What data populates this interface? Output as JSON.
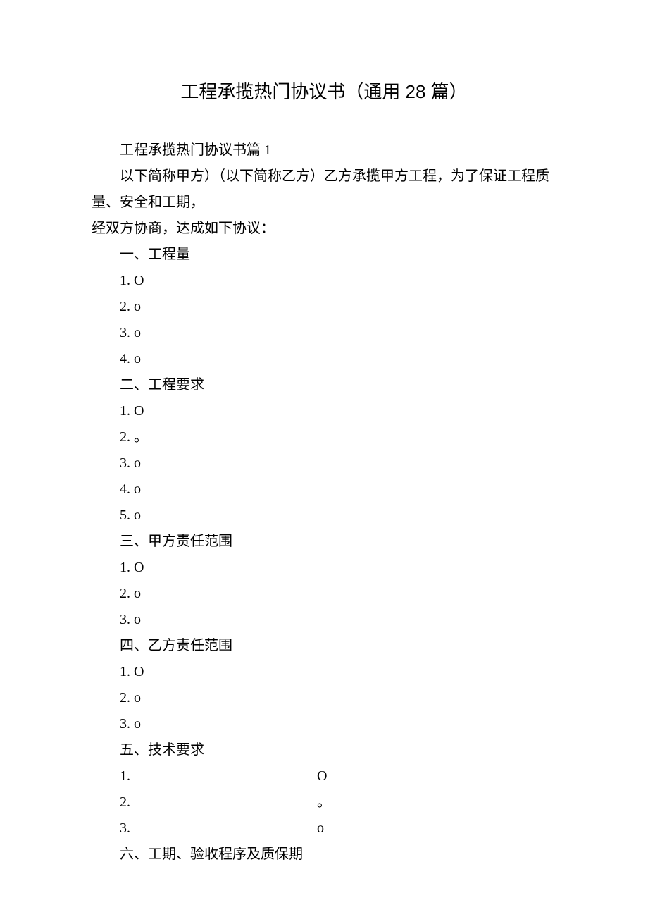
{
  "title": "工程承揽热门协议书（通用 28 篇）",
  "para1": "工程承揽热门协议书篇 1",
  "para2": "以下简称甲方）（以下简称乙方）乙方承揽甲方工程，为了保证工程质量、安全和工期，",
  "para3": "经双方协商，达成如下协议：",
  "sec1_heading": "一、工程量",
  "sec1_items": [
    "1. O",
    "2. o",
    "3. o",
    "4. o"
  ],
  "sec2_heading": "二、工程要求",
  "sec2_items": [
    "1. O",
    "2. 。",
    "3. o",
    "4. o",
    "5. o"
  ],
  "sec3_heading": "三、甲方责任范围",
  "sec3_items": [
    "1. O",
    "2. o",
    "3. o"
  ],
  "sec4_heading": "四、乙方责任范围",
  "sec4_items": [
    "1. O",
    "2. o",
    "3. o"
  ],
  "sec5_heading": "五、技术要求",
  "sec5_rows": [
    {
      "left": "1.",
      "right": "O"
    },
    {
      "left": "2.",
      "right": "。"
    },
    {
      "left": "3.",
      "right": "o"
    }
  ],
  "sec6_heading": "六、工期、验收程序及质保期"
}
